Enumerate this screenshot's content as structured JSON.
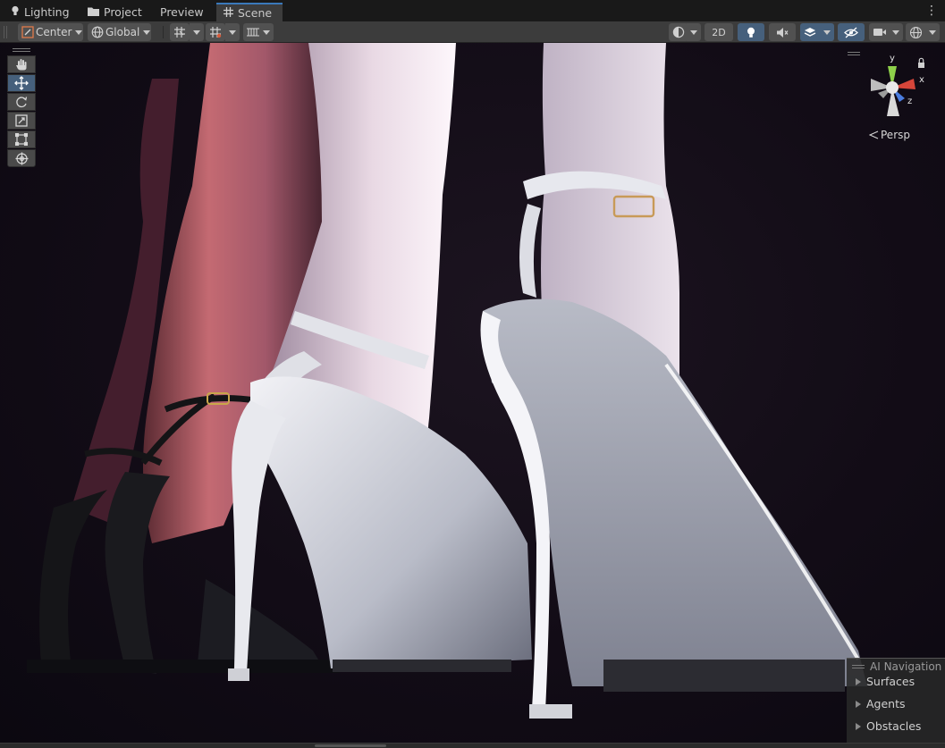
{
  "tabs": [
    {
      "label": "Lighting",
      "icon": "lightbulb-icon"
    },
    {
      "label": "Project",
      "icon": "folder-icon"
    },
    {
      "label": "Preview",
      "icon": ""
    },
    {
      "label": "Scene",
      "icon": "grid-hash-icon",
      "active": true
    }
  ],
  "toolbar": {
    "pivot_label": "Center",
    "space_label": "Global",
    "mode_2d_label": "2D"
  },
  "tools": [
    {
      "name": "hand-tool",
      "icon": "hand-icon"
    },
    {
      "name": "move-tool",
      "icon": "move-arrows-icon",
      "active": true
    },
    {
      "name": "rotate-tool",
      "icon": "rotate-icon"
    },
    {
      "name": "scale-tool",
      "icon": "scale-icon"
    },
    {
      "name": "rect-tool",
      "icon": "rect-transform-icon"
    },
    {
      "name": "transform-tool",
      "icon": "transform-icon"
    }
  ],
  "gizmo": {
    "projection_label": "Persp",
    "axes": [
      "y",
      "x",
      "z"
    ],
    "colors": {
      "x": "#d6463a",
      "y": "#8ed14a",
      "z": "#4a7de0"
    }
  },
  "ai_navigation": {
    "title": "AI Navigation",
    "items": [
      "Surfaces",
      "Agents",
      "Obstacles"
    ]
  },
  "colors": {
    "accent": "#3a79bb",
    "toolbar_bg": "#3c3c3c",
    "toggle_on": "#46607c"
  }
}
